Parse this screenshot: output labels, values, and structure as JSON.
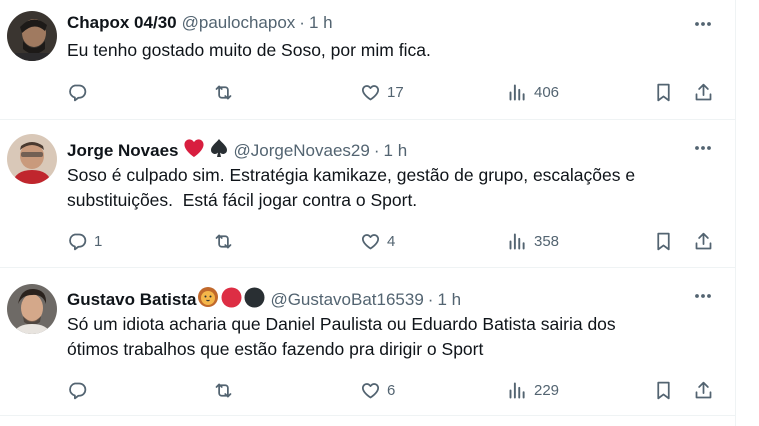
{
  "tweets": [
    {
      "display_name": "Chapox 04/30",
      "handle": "@paulochapox",
      "separator": "·",
      "time": "1 h",
      "text": "Eu tenho gostado muito de Soso, por mim fica.",
      "replies": "",
      "retweets": "",
      "likes": "17",
      "views": "406"
    },
    {
      "display_name": "Jorge Novaes",
      "handle": "@JorgeNovaes29",
      "separator": "·",
      "time": "1 h",
      "text": "Soso é culpado sim. Estratégia kamikaze, gestão de grupo, escalações e\nsubstituições.  Está fácil jogar contra o Sport.",
      "replies": "1",
      "retweets": "",
      "likes": "4",
      "views": "358"
    },
    {
      "display_name": "Gustavo Batista",
      "handle": "@GustavoBat16539",
      "separator": "·",
      "time": "1 h",
      "text": "Só um idiota acharia que Daniel Paulista ou Eduardo Batista sairia dos\nótimos trabalhos que estão fazendo pra dirigir o Sport",
      "replies": "",
      "retweets": "",
      "likes": "6",
      "views": "229"
    }
  ],
  "icons": {
    "more": "more-horizontal-icon",
    "reply": "reply-icon",
    "retweet": "retweet-icon",
    "like": "heart-icon",
    "views": "views-chart-icon",
    "bookmark": "bookmark-icon",
    "share": "share-icon"
  },
  "colors": {
    "text": "#0f1419",
    "secondary": "#536471",
    "border": "#eff3f4",
    "heart_emoji": "#d81e3f",
    "red_circle": "#dd2e44",
    "black_circle": "#292f33"
  }
}
